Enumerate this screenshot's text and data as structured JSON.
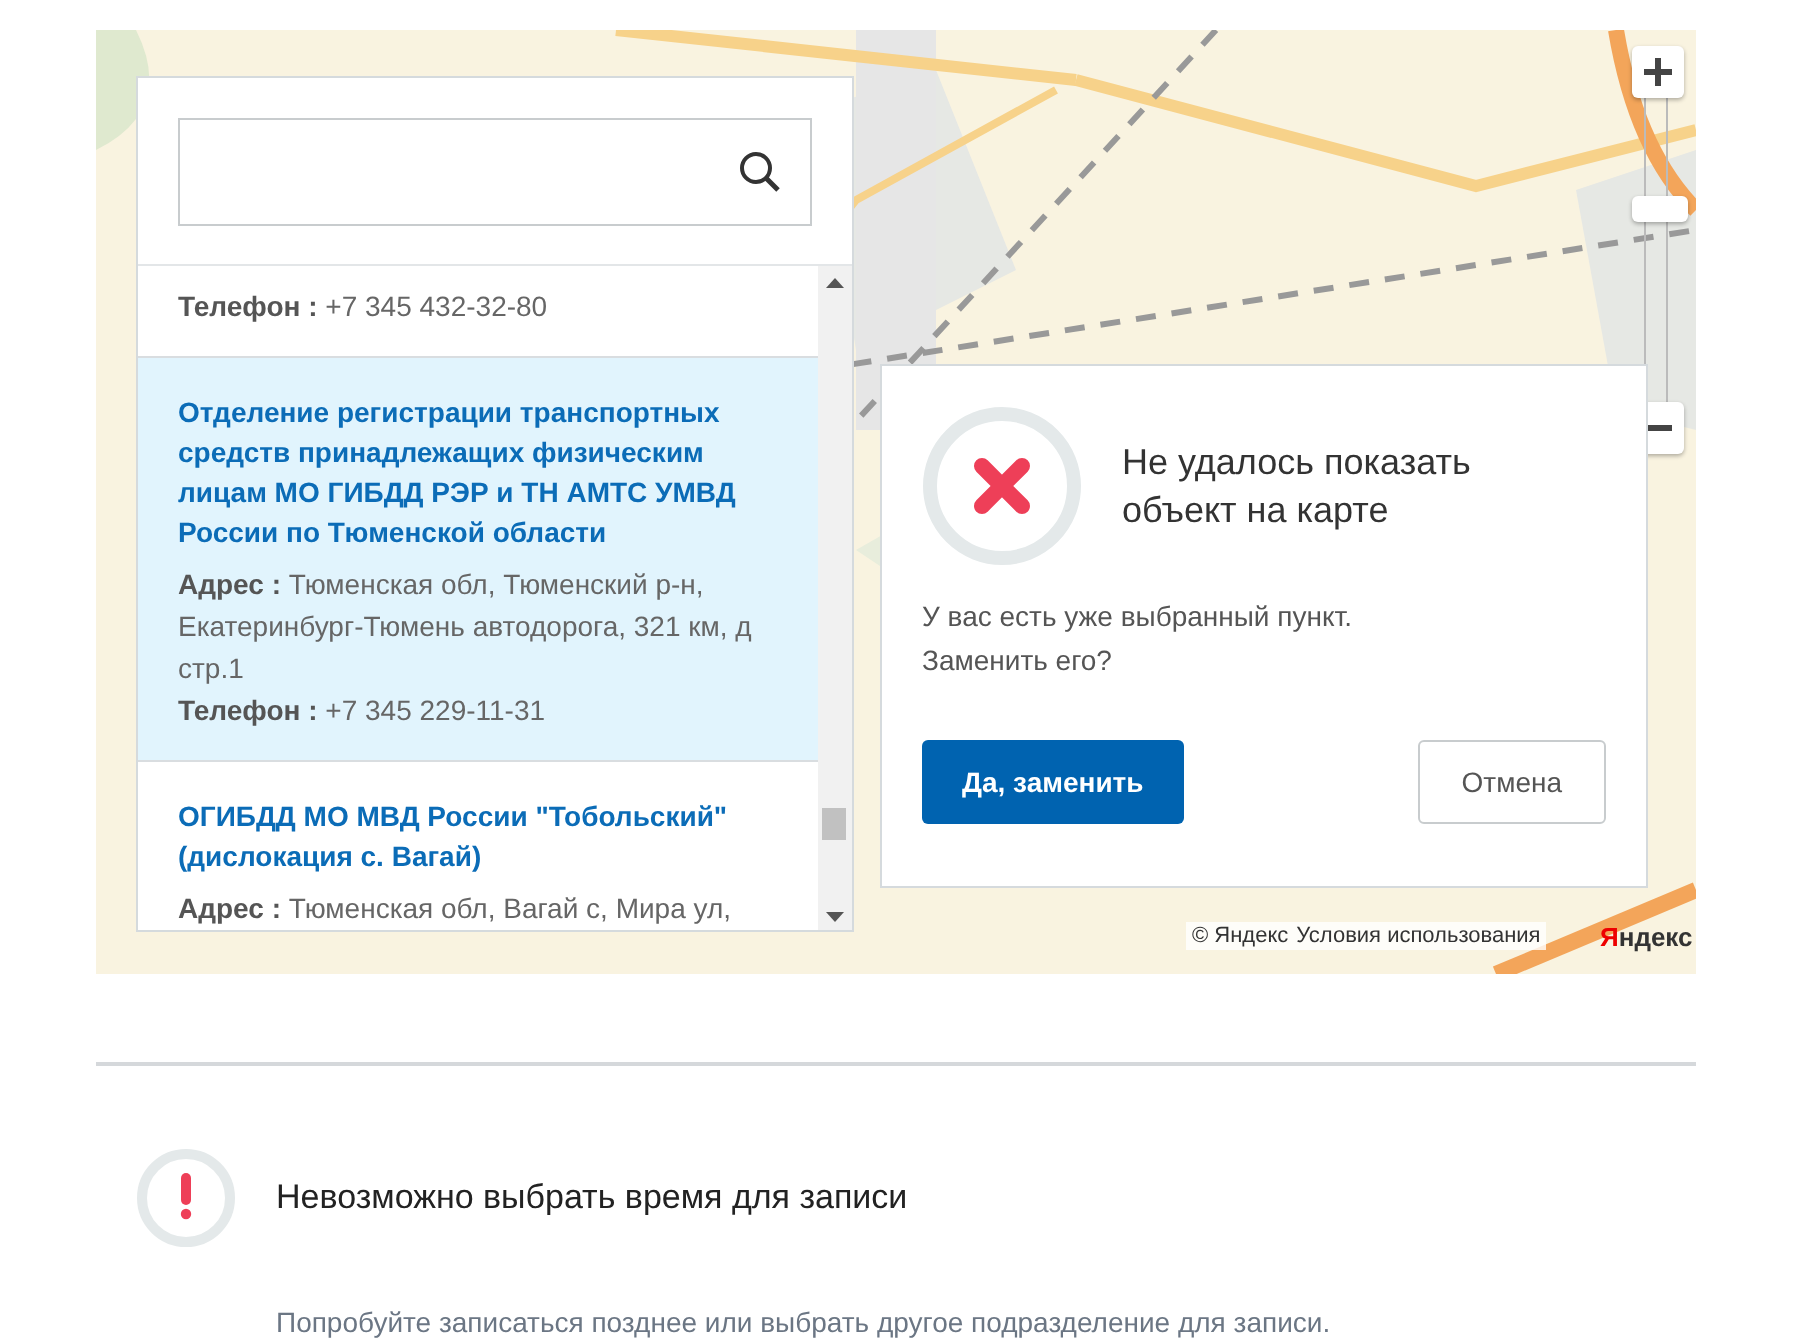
{
  "list": {
    "items": [
      {
        "phone_label": "Телефон :",
        "phone": "+7 345 432-32-80",
        "selected": false
      },
      {
        "title": "Отделение регистрации транспортных средств принадлежащих физическим лицам МО ГИБДД РЭР и ТН АМТС УМВД России по Тюменской области",
        "address_label": "Адрес :",
        "address": "Тюменская обл, Тюменский р-н, Екатеринбург-Тюмень автодорога, 321 км, д стр.1",
        "phone_label": "Телефон :",
        "phone": "+7 345 229-11-31",
        "selected": true
      },
      {
        "title": "ОГИБДД МО МВД России \"Тобольский\" (дислокация с. Вагай)",
        "address_label": "Адрес :",
        "address": "Тюменская обл, Вагай с, Мира ул,",
        "selected": false
      }
    ]
  },
  "dialog": {
    "title": "Не удалось показать объект на карте",
    "message_lines": [
      "У вас есть уже выбранный пункт.",
      "Заменить его?"
    ],
    "buttons": [
      {
        "label": "Да, заменить",
        "kind": "primary"
      },
      {
        "label": "Отмена",
        "kind": "secondary"
      }
    ]
  },
  "attribution": {
    "copyright": "© Яндекс",
    "terms_link": "Условия использования",
    "logo": "Яндекс"
  },
  "notice": {
    "title": "Невозможно выбрать время для записи",
    "text": "Попробуйте записаться позднее или выбрать другое подразделение для записи."
  }
}
